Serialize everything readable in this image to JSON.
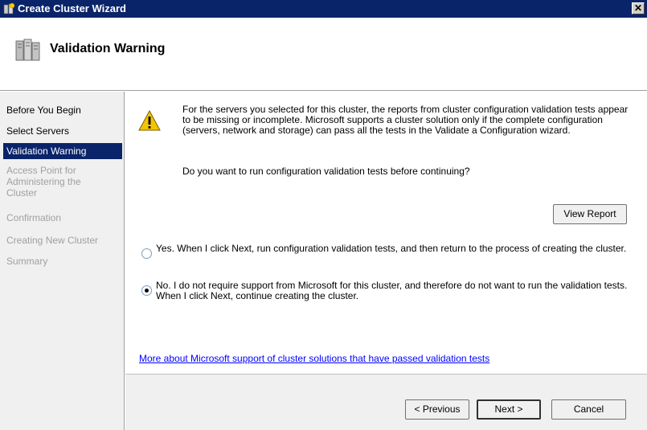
{
  "window": {
    "title": "Create Cluster Wizard",
    "close_glyph": "✕"
  },
  "header": {
    "title": "Validation Warning",
    "icon": "server-cluster-icon"
  },
  "sidebar": {
    "items": [
      {
        "label": "Before You Begin",
        "state": "normal"
      },
      {
        "label": "Select Servers",
        "state": "normal"
      },
      {
        "label": "Validation Warning",
        "state": "active"
      },
      {
        "label": "Access Point for Administering the Cluster",
        "state": "disabled"
      },
      {
        "label": "Confirmation",
        "state": "disabled"
      },
      {
        "label": "Creating New Cluster",
        "state": "disabled"
      },
      {
        "label": "Summary",
        "state": "disabled"
      }
    ]
  },
  "main": {
    "warning_icon": "warning-triangle-icon",
    "description": "For the servers you selected for this cluster, the reports from cluster configuration validation tests appear to be missing or incomplete.  Microsoft supports a cluster solution only if the complete configuration (servers, network and storage) can pass all the tests in the Validate a Configuration wizard.",
    "question": "Do you want to run configuration validation tests before continuing?",
    "view_report_label": "View Report",
    "options": [
      {
        "label": "Yes.  When I click Next, run configuration validation tests, and then return to the process of creating the cluster.",
        "checked": false
      },
      {
        "label": "No.  I do not require support from Microsoft for this cluster, and therefore do not want to run the validation tests.  When I click Next, continue creating the cluster.",
        "checked": true
      }
    ],
    "help_link": "More about Microsoft support of cluster solutions that have passed validation tests"
  },
  "footer": {
    "previous_label": "< Previous",
    "next_label": "Next >",
    "cancel_label": "Cancel"
  },
  "colors": {
    "title_bar": "#0a246a",
    "active_nav": "#0a246a",
    "link": "#0000ff",
    "warning": "#f5c400"
  }
}
